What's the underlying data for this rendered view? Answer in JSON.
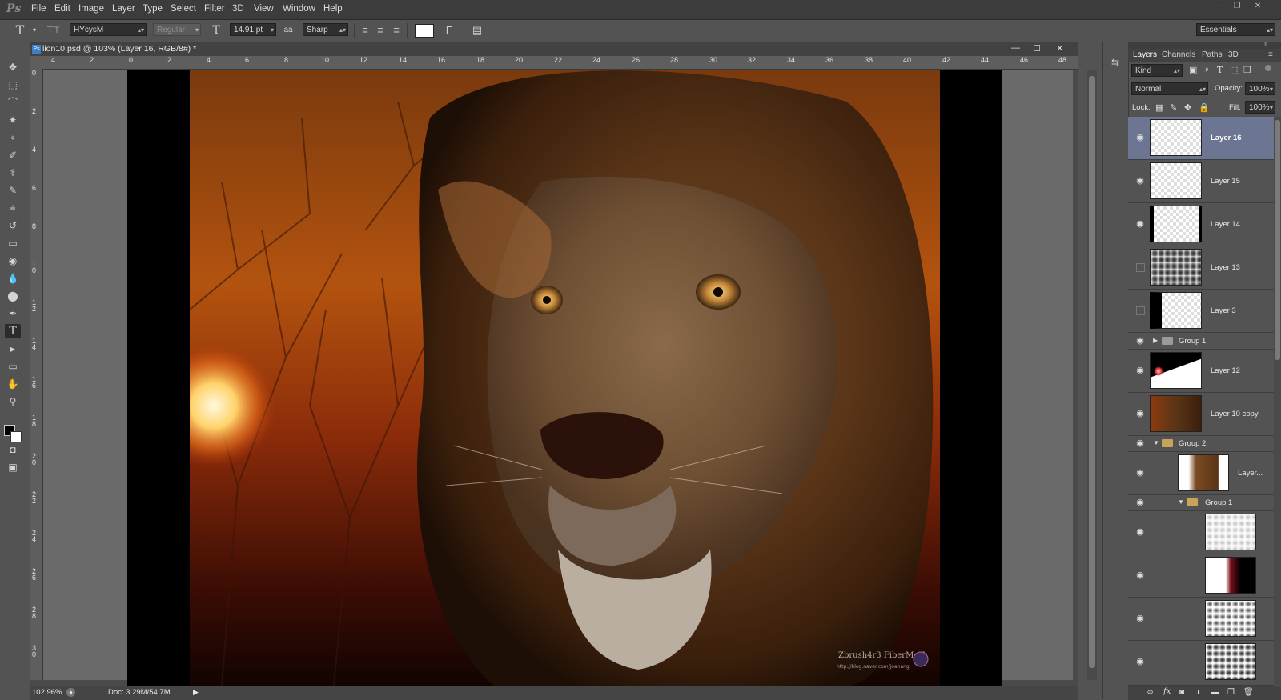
{
  "app": {
    "logo": "Ps"
  },
  "menu": [
    "File",
    "Edit",
    "Image",
    "Layer",
    "Type",
    "Select",
    "Filter",
    "3D",
    "View",
    "Window",
    "Help"
  ],
  "options": {
    "font_family": "HYcysM",
    "font_style": "Regular",
    "font_size": "14.91 pt",
    "aa_label": "aa",
    "antialias": "Sharp",
    "workspace": "Essentials"
  },
  "document": {
    "tab_title": "lion10.psd @ 103% (Layer 16, RGB/8#) *",
    "zoom": "102.96%",
    "doc_size": "Doc: 3.29M/54.7M",
    "ruler_top": [
      "4",
      "2",
      "0",
      "2",
      "4",
      "6",
      "8",
      "10",
      "12",
      "14",
      "16",
      "18",
      "20",
      "22",
      "24",
      "26",
      "28",
      "30",
      "32",
      "34",
      "36",
      "38",
      "40",
      "42",
      "44",
      "46",
      "48"
    ],
    "ruler_left": [
      "0",
      "2",
      "4",
      "6",
      "8",
      "1 0",
      "1 2",
      "1 4",
      "1 6",
      "1 8",
      "2 0",
      "2 2",
      "2 4",
      "2 6",
      "2 8",
      "3 0"
    ],
    "watermark_line1": "Zbrush4r3  FiberMesh",
    "watermark_line2": "http://blog.naver.com/joahang"
  },
  "panel": {
    "tabs": [
      "Layers",
      "Channels",
      "Paths",
      "3D"
    ],
    "kind_label": "Kind",
    "blend_mode": "Normal",
    "opacity_label": "Opacity:",
    "opacity": "100%",
    "lock_label": "Lock:",
    "fill_label": "Fill:",
    "fill": "100%",
    "layers": [
      {
        "name": "Layer 16",
        "visible": true,
        "selected": true
      },
      {
        "name": "Layer 15",
        "visible": true
      },
      {
        "name": "Layer 14",
        "visible": true
      },
      {
        "name": "Layer 13",
        "visible": false
      },
      {
        "name": "Layer 3",
        "visible": false
      },
      {
        "name": "Group 1",
        "visible": true,
        "group": true
      },
      {
        "name": "Layer 12",
        "visible": true
      },
      {
        "name": "Layer 10 copy",
        "visible": true
      },
      {
        "name": "Group 2",
        "visible": true,
        "group": true
      },
      {
        "name": "Layer...",
        "visible": true
      },
      {
        "name": "Group 1",
        "visible": true,
        "group": true
      }
    ]
  }
}
